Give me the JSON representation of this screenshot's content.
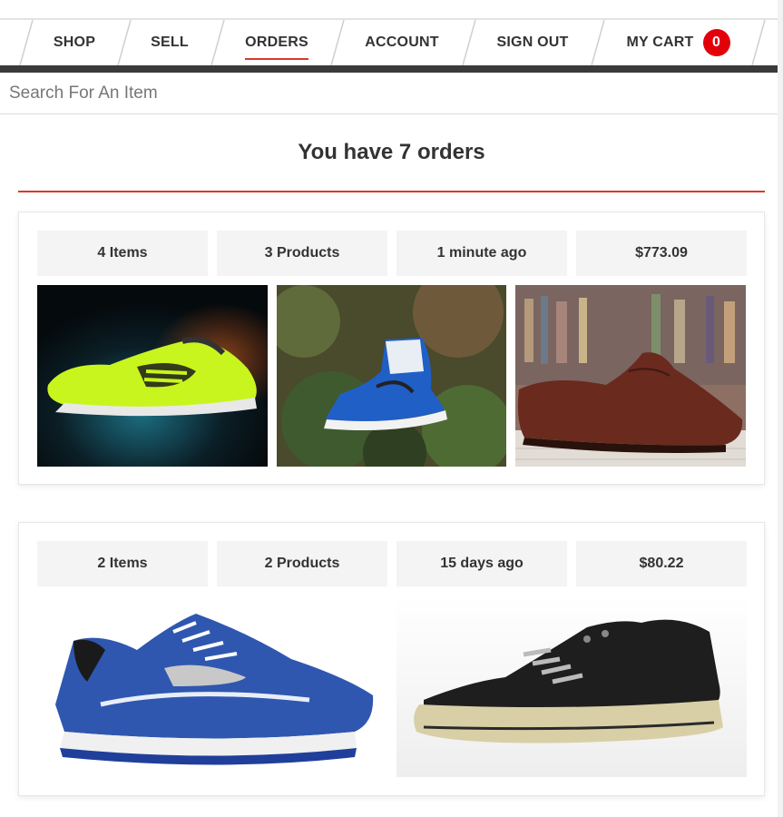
{
  "nav": {
    "items": [
      {
        "key": "shop",
        "label": "SHOP"
      },
      {
        "key": "sell",
        "label": "SELL"
      },
      {
        "key": "orders",
        "label": "ORDERS"
      },
      {
        "key": "account",
        "label": "ACCOUNT"
      },
      {
        "key": "signout",
        "label": "SIGN OUT"
      },
      {
        "key": "cart",
        "label": "MY CART"
      }
    ],
    "active": "orders",
    "cart_count": "0",
    "accent_color": "#d63a2a",
    "badge_color": "#e3000b"
  },
  "search": {
    "placeholder": "Search For An Item"
  },
  "page": {
    "heading": "You have 7 orders"
  },
  "orders": [
    {
      "items": "4 Items",
      "products": "3 Products",
      "time": "1 minute ago",
      "total": "$773.09",
      "images": [
        "neon-running-shoe-icon",
        "blue-high-top-sneaker-icon",
        "brown-leather-shoe-icon"
      ]
    },
    {
      "items": "2 Items",
      "products": "2 Products",
      "time": "15 days ago",
      "total": "$80.22",
      "images": [
        "blue-running-shoe-icon",
        "black-canvas-sneaker-icon"
      ]
    }
  ]
}
